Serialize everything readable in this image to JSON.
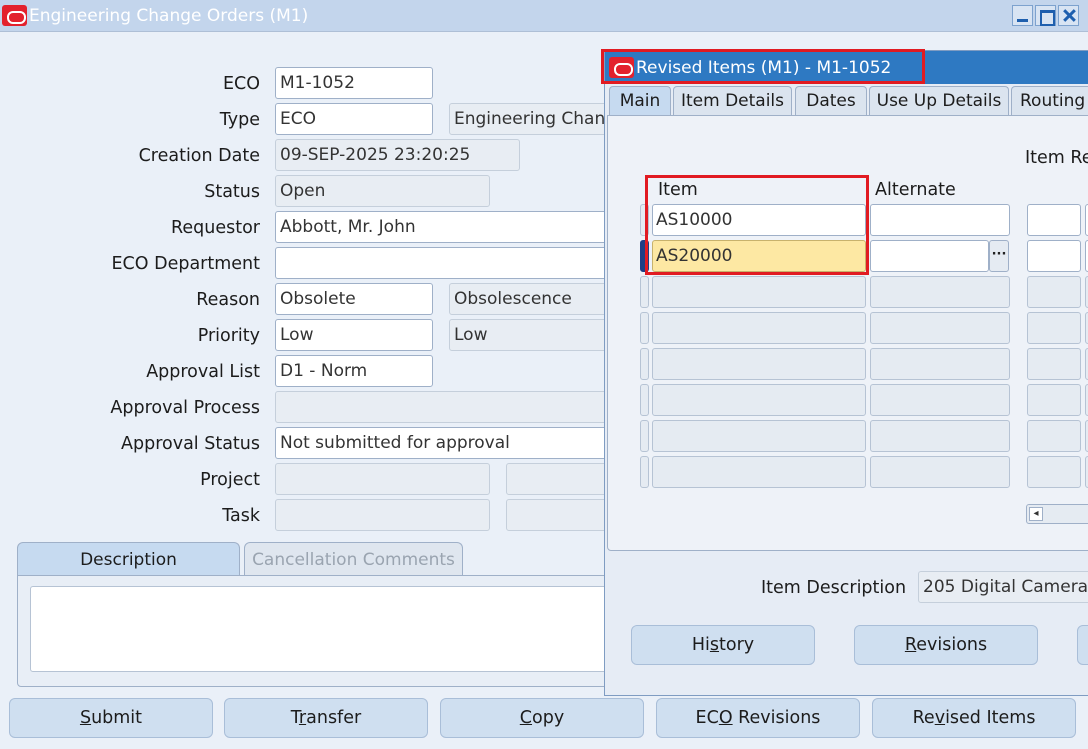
{
  "main_window": {
    "title": "Engineering Change Orders (M1)",
    "fields": {
      "eco": {
        "label": "ECO",
        "value": "M1-1052"
      },
      "type": {
        "label": "Type",
        "value": "ECO",
        "description": "Engineering Chan"
      },
      "creation_date": {
        "label": "Creation Date",
        "value": "09-SEP-2025 23:20:25"
      },
      "status": {
        "label": "Status",
        "value": "Open"
      },
      "requestor": {
        "label": "Requestor",
        "value": "Abbott, Mr. John"
      },
      "eco_department": {
        "label": "ECO Department",
        "value": ""
      },
      "reason": {
        "label": "Reason",
        "value": "Obsolete",
        "description": "Obsolescence"
      },
      "priority": {
        "label": "Priority",
        "value": "Low",
        "description": "Low"
      },
      "approval_list": {
        "label": "Approval List",
        "value": "D1 - Norm"
      },
      "approval_process": {
        "label": "Approval Process",
        "value": ""
      },
      "approval_status": {
        "label": "Approval Status",
        "value": "Not submitted for approval"
      },
      "project": {
        "label": "Project",
        "value": ""
      },
      "task": {
        "label": "Task",
        "value": ""
      }
    },
    "tabs": [
      {
        "label": "Description",
        "active": true
      },
      {
        "label": "Cancellation Comments",
        "active": false
      }
    ],
    "buttons": {
      "submit": {
        "pre": "",
        "key": "S",
        "post": "ubmit"
      },
      "transfer": {
        "pre": "T",
        "key": "r",
        "post": "ansfer"
      },
      "copy": {
        "pre": "",
        "key": "C",
        "post": "opy"
      },
      "eco_revisions": {
        "pre": "EC",
        "key": "O",
        "post": " Revisions"
      },
      "revised_items": {
        "pre": "Re",
        "key": "v",
        "post": "ised Items"
      }
    }
  },
  "revised_items_window": {
    "title": "Revised Items (M1) - M1-1052",
    "tabs": [
      {
        "label": "Main",
        "active": true
      },
      {
        "label": "Item Details",
        "active": false
      },
      {
        "label": "Dates",
        "active": false
      },
      {
        "label": "Use Up Details",
        "active": false
      },
      {
        "label": "Routing",
        "active": false
      }
    ],
    "columns": {
      "item": "Item",
      "alternate": "Alternate",
      "item_rev": "Item Re"
    },
    "rows": [
      {
        "item": "AS10000",
        "alternate": ""
      },
      {
        "item": "AS20000",
        "alternate": ""
      }
    ],
    "empty_rows": 6,
    "item_description": {
      "label": "Item Description",
      "value": "205 Digital Camera"
    },
    "buttons": {
      "history": {
        "pre": "Hi",
        "key": "s",
        "post": "tory"
      },
      "revisions": {
        "pre": "",
        "key": "R",
        "post": "evisions"
      }
    }
  },
  "colors": {
    "accent_blue": "#2e79c2",
    "highlight_red": "#e11b22",
    "selected_cell": "#fde8a3",
    "oracle_red": "#e3212d"
  }
}
